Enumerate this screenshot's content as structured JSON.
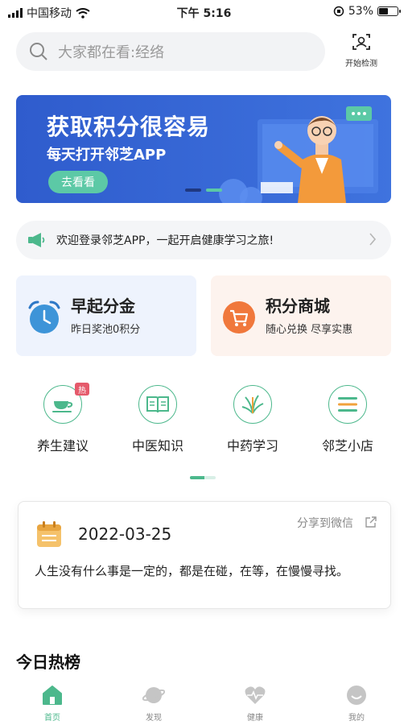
{
  "status_bar": {
    "carrier": "中国移动",
    "time": "下午 5:16",
    "battery_text": "53%",
    "battery_level": 0.53
  },
  "search": {
    "placeholder": "大家都在看:经络",
    "scan_label": "开始检测"
  },
  "banner": {
    "title": "获取积分很容易",
    "subtitle": "每天打开邻芝APP",
    "button_label": "去看看",
    "active_slide": 2,
    "slide_count": 2
  },
  "notice": {
    "text": "欢迎登录邻芝APP，一起开启健康学习之旅!"
  },
  "cards": [
    {
      "title": "早起分金",
      "subtitle": "昨日奖池0积分",
      "icon": "alarm-clock-icon",
      "color": "#3d8fd6"
    },
    {
      "title": "积分商城",
      "subtitle": "随心兑换 尽享实惠",
      "icon": "shopping-cart-icon",
      "color": "#f0783c"
    }
  ],
  "categories": [
    {
      "label": "养生建议",
      "icon": "tea-cup-icon",
      "badge": "热"
    },
    {
      "label": "中医知识",
      "icon": "book-icon"
    },
    {
      "label": "中药学习",
      "icon": "herb-icon"
    },
    {
      "label": "邻芝小店",
      "icon": "shop-list-icon"
    }
  ],
  "daily": {
    "date": "2022-03-25",
    "share_label": "分享到微信",
    "quote": "人生没有什么事是一定的，都是在碰，在等，在慢慢寻找。"
  },
  "hot_list": {
    "title": "今日热榜"
  },
  "tabbar": [
    {
      "label": "首页",
      "icon": "home-icon",
      "active": true
    },
    {
      "label": "发现",
      "icon": "planet-icon",
      "active": false
    },
    {
      "label": "健康",
      "icon": "heart-pulse-icon",
      "active": false
    },
    {
      "label": "我的",
      "icon": "profile-icon",
      "active": false
    }
  ],
  "colors": {
    "accent": "#4cb88c",
    "banner_blue": "#3564d4"
  }
}
